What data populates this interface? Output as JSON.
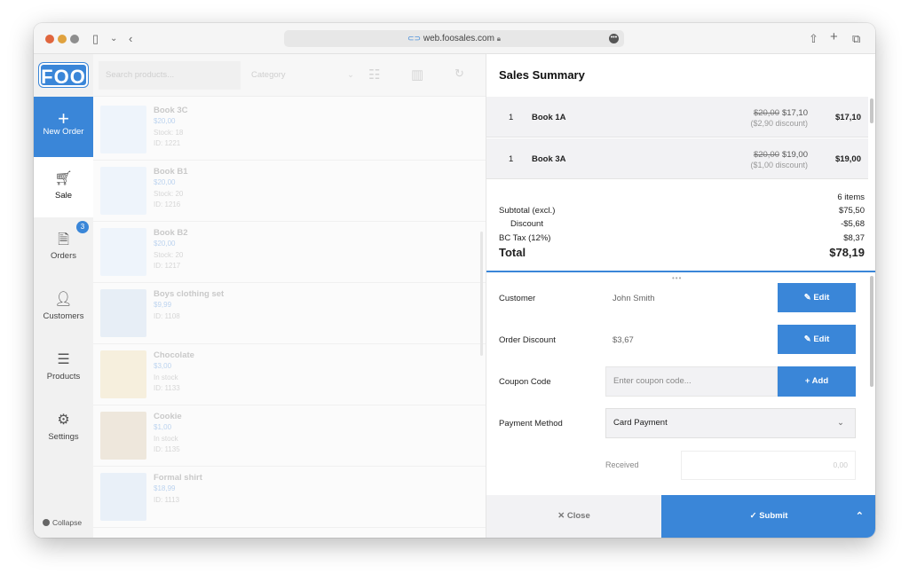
{
  "browser": {
    "url": "web.foosales.com",
    "dots": [
      "#e0663e",
      "#e0a23e",
      "#8e8e8e"
    ]
  },
  "sidebar": {
    "logo": "FOO",
    "items": [
      {
        "label": "New Order",
        "icon": "plus-icon"
      },
      {
        "label": "Sale",
        "icon": "cart-icon"
      },
      {
        "label": "Orders",
        "icon": "receipt-icon",
        "badge": "3"
      },
      {
        "label": "Customers",
        "icon": "person-icon"
      },
      {
        "label": "Products",
        "icon": "list-icon"
      },
      {
        "label": "Settings",
        "icon": "gear-icon"
      }
    ],
    "collapse": "Collapse"
  },
  "products": {
    "search_placeholder": "Search products...",
    "category": "Category",
    "items": [
      {
        "name": "Book 3C",
        "price": "$20,00",
        "meta1": "Stock: 18",
        "meta2": "ID: 1221"
      },
      {
        "name": "Book B1",
        "price": "$20,00",
        "meta1": "Stock: 20",
        "meta2": "ID: 1216"
      },
      {
        "name": "Book B2",
        "price": "$20,00",
        "meta1": "Stock: 20",
        "meta2": "ID: 1217"
      },
      {
        "name": "Boys clothing set",
        "price": "$9,99",
        "meta1": "ID: 1108",
        "meta2": ""
      },
      {
        "name": "Chocolate",
        "price": "$3,00",
        "meta1": "In stock",
        "meta2": "ID: 1133"
      },
      {
        "name": "Cookie",
        "price": "$1,00",
        "meta1": "In stock",
        "meta2": "ID: 1135"
      },
      {
        "name": "Formal shirt",
        "price": "$18,99",
        "meta1": "ID: 1113",
        "meta2": ""
      }
    ]
  },
  "summary": {
    "title": "Sales Summary",
    "lines": [
      {
        "qty": "1",
        "name": "Book 1A",
        "orig": "$20,00",
        "price": "$17,10",
        "discount": "($2,90 discount)",
        "total": "$17,10"
      },
      {
        "qty": "1",
        "name": "Book 3A",
        "orig": "$20,00",
        "price": "$19,00",
        "discount": "($1,00 discount)",
        "total": "$19,00"
      }
    ],
    "items_count": "6 items",
    "subtotal_label": "Subtotal (excl.)",
    "subtotal": "$75,50",
    "discount_label": "Discount",
    "discount": "-$5,68",
    "tax_label": "BC Tax (12%)",
    "tax": "$8,37",
    "total_label": "Total",
    "total": "$78,19"
  },
  "form": {
    "customer_label": "Customer",
    "customer_value": "John Smith",
    "edit_label": "Edit",
    "order_discount_label": "Order Discount",
    "order_discount_value": "$3,67",
    "coupon_label": "Coupon Code",
    "coupon_placeholder": "Enter coupon code...",
    "add_label": "+ Add",
    "payment_label": "Payment Method",
    "payment_value": "Card Payment",
    "received_label": "Received",
    "received_value": "0,00"
  },
  "footer": {
    "close": "Close",
    "submit": "Submit"
  },
  "colors": {
    "accent": "#3a86d8"
  }
}
